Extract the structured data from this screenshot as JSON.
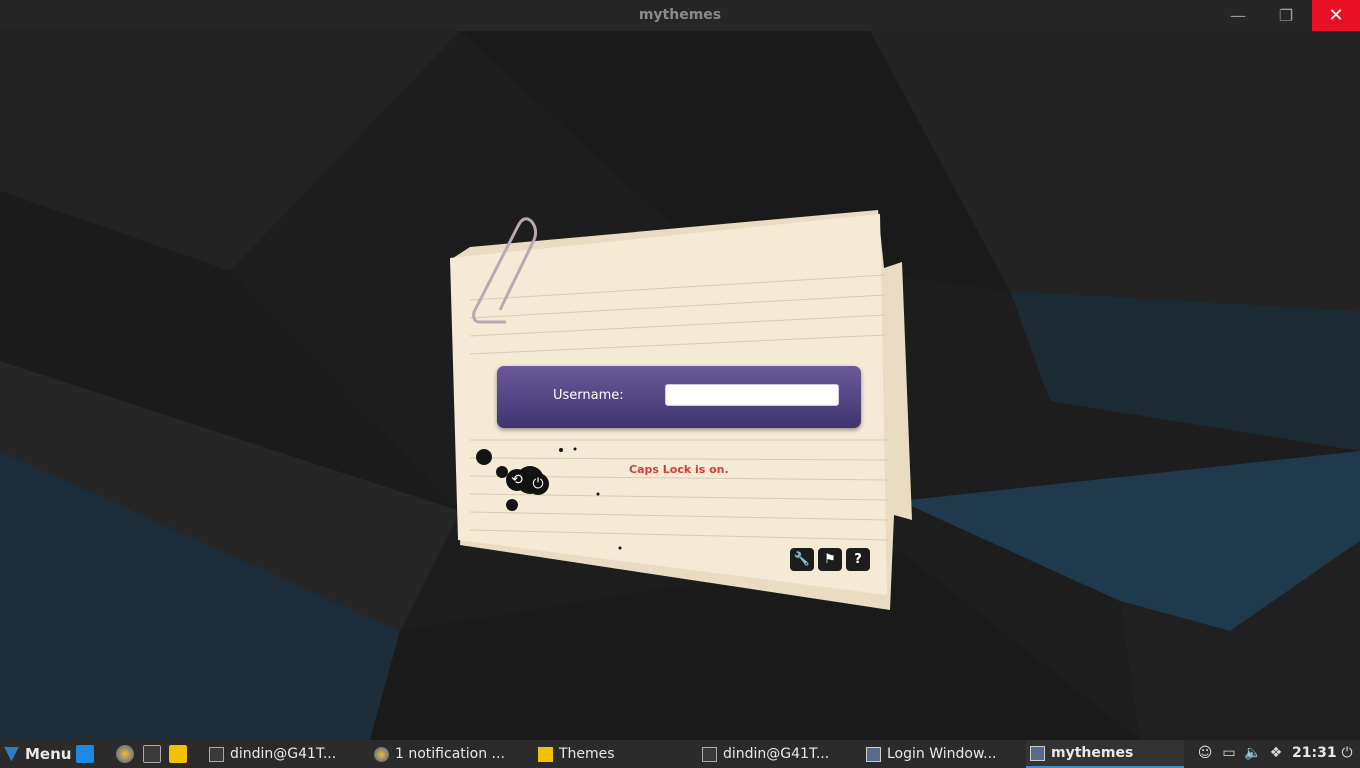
{
  "window": {
    "title": "mythemes",
    "minimize": "—",
    "maximize": "❐",
    "close": "✕"
  },
  "login": {
    "username_label": "Username:",
    "username_value": "",
    "caps_warning": "Caps Lock is on.",
    "tools": [
      {
        "icon": "wrench-icon",
        "glyph": "🔧"
      },
      {
        "icon": "flag-icon",
        "glyph": "⚑"
      },
      {
        "icon": "help-icon",
        "glyph": "?"
      }
    ]
  },
  "taskbar": {
    "menu_label": "Menu",
    "tasks": [
      {
        "label": "dindin@G41T...",
        "icon": "terminal-icon"
      },
      {
        "label": "1 notification ...",
        "icon": "firefox-icon"
      },
      {
        "label": "Themes",
        "icon": "folder-icon"
      },
      {
        "label": "dindin@G41T...",
        "icon": "terminal-icon"
      },
      {
        "label": "Login Window...",
        "icon": "login-window-icon"
      },
      {
        "label": "mythemes",
        "icon": "mythemes-icon"
      }
    ],
    "clock": "21:31"
  },
  "colors": {
    "accent": "#3d8fd6",
    "close": "#e81123",
    "caps": "#d83b3b",
    "login_box": "#4f4384"
  }
}
